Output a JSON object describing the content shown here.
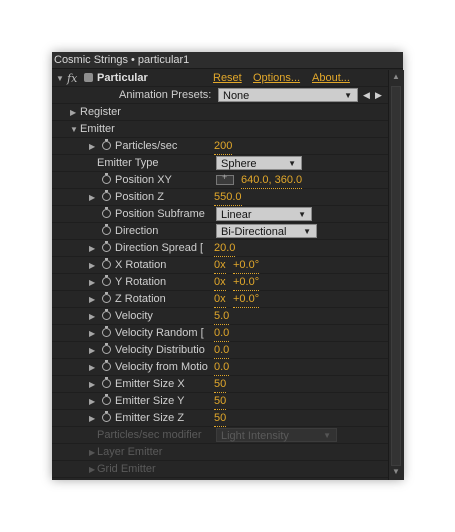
{
  "panel": {
    "title": "Cosmic Strings • particular1",
    "effect": {
      "name": "Particular",
      "reset": "Reset",
      "options": "Options...",
      "about": "About..."
    },
    "presets": {
      "label": "Animation Presets:",
      "value": "None"
    },
    "register": "Register",
    "emitter": "Emitter",
    "properties": [
      {
        "label": "Particles/sec",
        "value": "200"
      },
      {
        "label": "Emitter Type",
        "value": "Sphere"
      },
      {
        "label": "Position XY",
        "value": "640.0, 360.0"
      },
      {
        "label": "Position Z",
        "value": "550.0"
      },
      {
        "label": "Position Subframe",
        "value": "Linear"
      },
      {
        "label": "Direction",
        "value": "Bi-Directional"
      },
      {
        "label": "Direction Spread [",
        "value": "20.0"
      },
      {
        "label": "X Rotation",
        "value": "0x",
        "value2": "+0.0°"
      },
      {
        "label": "Y Rotation",
        "value": "0x",
        "value2": "+0.0°"
      },
      {
        "label": "Z Rotation",
        "value": "0x",
        "value2": "+0.0°"
      },
      {
        "label": "Velocity",
        "value": "5.0"
      },
      {
        "label": "Velocity Random [",
        "value": "0.0"
      },
      {
        "label": "Velocity Distributio",
        "value": "0.0"
      },
      {
        "label": "Velocity from Motio",
        "value": "0.0"
      },
      {
        "label": "Emitter Size X",
        "value": "50"
      },
      {
        "label": "Emitter Size Y",
        "value": "50"
      },
      {
        "label": "Emitter Size Z",
        "value": "50"
      },
      {
        "label": "Particles/sec modifier",
        "value": "Light Intensity"
      }
    ],
    "layer_emitter": "Layer Emitter",
    "grid_emitter": "Grid Emitter"
  },
  "colors": {
    "value": "#e2a82b",
    "background": "#262626",
    "text": "#cfcfcf",
    "disabled": "#5a5a5a"
  }
}
